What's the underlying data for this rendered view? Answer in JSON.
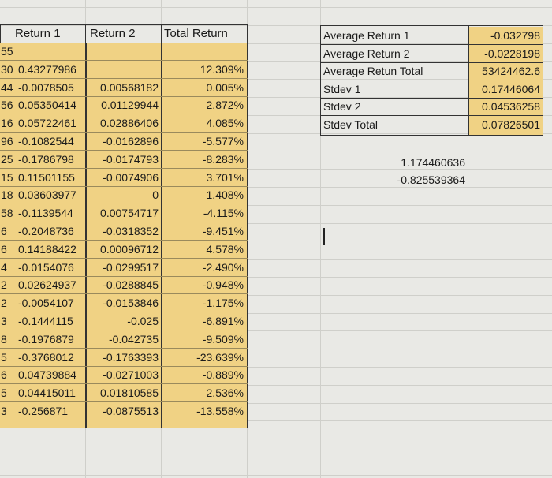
{
  "colors": {
    "highlight": "#f0d284",
    "grid": "#cfcfca",
    "background": "#e9e9e5"
  },
  "headers": {
    "return1": "Return 1",
    "return2": "Return 2",
    "total": "Total Return"
  },
  "rows": [
    {
      "a": "55",
      "r1": "",
      "r2": "",
      "t": ""
    },
    {
      "a": "30",
      "r1": "0.43277986",
      "r2": "",
      "t": "12.309%"
    },
    {
      "a": "44",
      "r1": "-0.0078505",
      "r2": "0.00568182",
      "t": "0.005%"
    },
    {
      "a": "56",
      "r1": "0.05350414",
      "r2": "0.01129944",
      "t": "2.872%"
    },
    {
      "a": "16",
      "r1": "0.05722461",
      "r2": "0.02886406",
      "t": "4.085%"
    },
    {
      "a": "96",
      "r1": "-0.1082544",
      "r2": "-0.0162896",
      "t": "-5.577%"
    },
    {
      "a": "25",
      "r1": "-0.1786798",
      "r2": "-0.0174793",
      "t": "-8.283%"
    },
    {
      "a": "15",
      "r1": "0.11501155",
      "r2": "-0.0074906",
      "t": "3.701%"
    },
    {
      "a": "18",
      "r1": "0.03603977",
      "r2": "0",
      "t": "1.408%"
    },
    {
      "a": "58",
      "r1": "-0.1139544",
      "r2": "0.00754717",
      "t": "-4.115%"
    },
    {
      "a": "6",
      "r1": "-0.2048736",
      "r2": "-0.0318352",
      "t": "-9.451%"
    },
    {
      "a": "6",
      "r1": "0.14188422",
      "r2": "0.00096712",
      "t": "4.578%"
    },
    {
      "a": "4",
      "r1": "-0.0154076",
      "r2": "-0.0299517",
      "t": "-2.490%"
    },
    {
      "a": "2",
      "r1": "0.02624937",
      "r2": "-0.0288845",
      "t": "-0.948%"
    },
    {
      "a": "2",
      "r1": "-0.0054107",
      "r2": "-0.0153846",
      "t": "-1.175%"
    },
    {
      "a": "3",
      "r1": "-0.1444115",
      "r2": "-0.025",
      "t": "-6.891%"
    },
    {
      "a": "8",
      "r1": "-0.1976879",
      "r2": "-0.042735",
      "t": "-9.509%"
    },
    {
      "a": "5",
      "r1": "-0.3768012",
      "r2": "-0.1763393",
      "t": "-23.639%"
    },
    {
      "a": "6",
      "r1": "0.04739884",
      "r2": "-0.0271003",
      "t": "-0.889%"
    },
    {
      "a": "5",
      "r1": "0.04415011",
      "r2": "0.01810585",
      "t": "2.536%"
    },
    {
      "a": "3",
      "r1": "-0.256871",
      "r2": "-0.0875513",
      "t": "-13.558%"
    }
  ],
  "stats": [
    {
      "label": "Average Return 1",
      "value": "-0.032798"
    },
    {
      "label": "Average Return 2",
      "value": "-0.0228198"
    },
    {
      "label": "Average Retun Total",
      "value": "53424462.6"
    },
    {
      "label": "Stdev 1",
      "value": "0.17446064"
    },
    {
      "label": "Stdev 2",
      "value": "0.04536258"
    },
    {
      "label": "Stdev Total",
      "value": "0.07826501"
    }
  ],
  "extra": {
    "v1": "1.174460636",
    "v2": "-0.825539364"
  }
}
